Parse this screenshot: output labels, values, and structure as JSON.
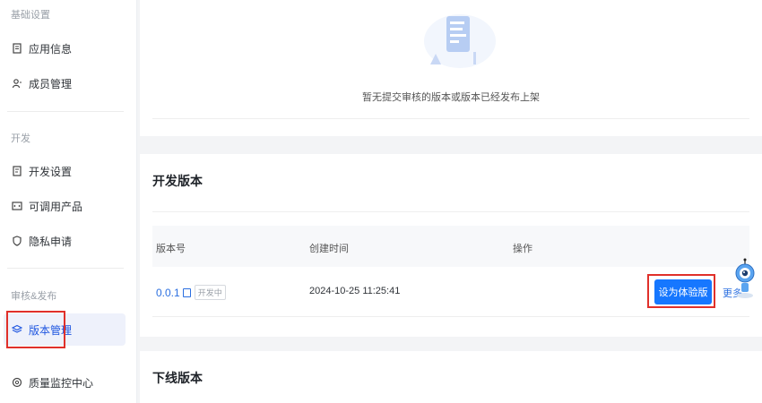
{
  "sidebar": {
    "section_basic": "基础设置",
    "item_app_info": "应用信息",
    "item_members": "成员管理",
    "section_dev": "开发",
    "item_dev_settings": "开发设置",
    "item_products": "可调用产品",
    "item_privacy": "隐私申请",
    "section_review": "审核&发布",
    "item_version": "版本管理",
    "item_quality": "质量监控中心"
  },
  "empty_state": {
    "text": "暂无提交审核的版本或版本已经发布上架"
  },
  "dev_versions": {
    "title": "开发版本",
    "columns": [
      "版本号",
      "创建时间",
      "操作"
    ],
    "rows": [
      {
        "version": "0.0.1",
        "badge": "开发中",
        "created_at": "2024-10-25 11:25:41",
        "primary_action": "设为体验版",
        "more": "更多"
      }
    ]
  },
  "offline_versions": {
    "title": "下线版本"
  },
  "colors": {
    "accent": "#1677ff",
    "highlight_box": "#e0302a",
    "active_bg": "#eef1fb"
  }
}
